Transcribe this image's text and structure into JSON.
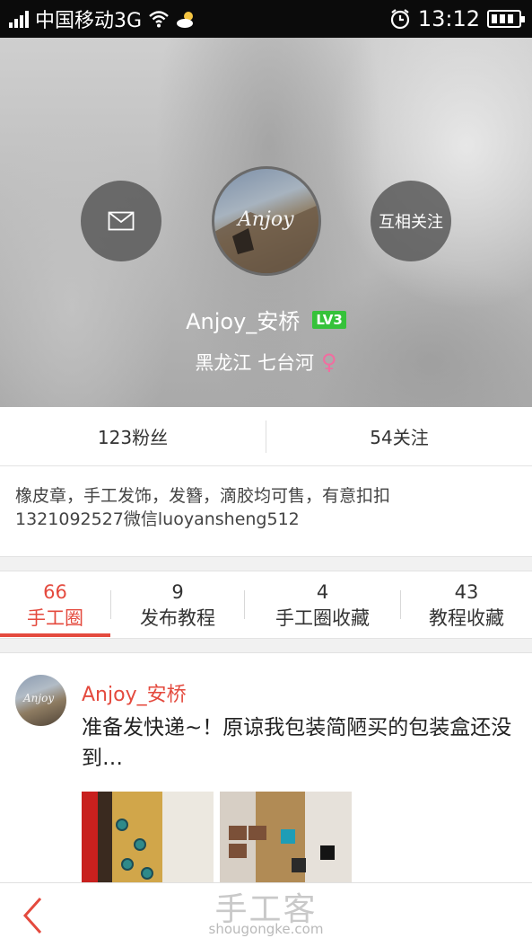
{
  "status_bar": {
    "carrier": "中国移动3G",
    "time": "13:12",
    "icons": [
      "signal-icon",
      "wifi-icon",
      "weather-icon",
      "alarm-icon",
      "battery-icon"
    ]
  },
  "profile": {
    "avatar_signature": "Anjoy",
    "name": "Anjoy_安桥",
    "level": "LV3",
    "location": "黑龙江 七台河",
    "gender_symbol": "♀",
    "follow_button_label": "互相关注"
  },
  "stats": {
    "fans": "123粉丝",
    "following": "54关注"
  },
  "bio": {
    "line1": "橡皮章，手工发饰，发簪，滴胶均可售，有意扣扣",
    "line2": "1321092527微信luoyansheng512"
  },
  "tabs": [
    {
      "count": "66",
      "label": "手工圈",
      "active": true
    },
    {
      "count": "9",
      "label": "发布教程",
      "active": false
    },
    {
      "count": "4",
      "label": "手工圈收藏",
      "active": false
    },
    {
      "count": "43",
      "label": "教程收藏",
      "active": false
    }
  ],
  "post": {
    "author": "Anjoy_安桥",
    "text": "准备发快递~！原谅我包装简陋买的包装盒还没到…",
    "avatar_signature": "Anjoy"
  },
  "watermark": {
    "brand": "手工客",
    "domain": "shougongke.com"
  },
  "colors": {
    "accent": "#e44a3e",
    "level_badge": "#36c23a",
    "gender": "#f06ea0"
  }
}
